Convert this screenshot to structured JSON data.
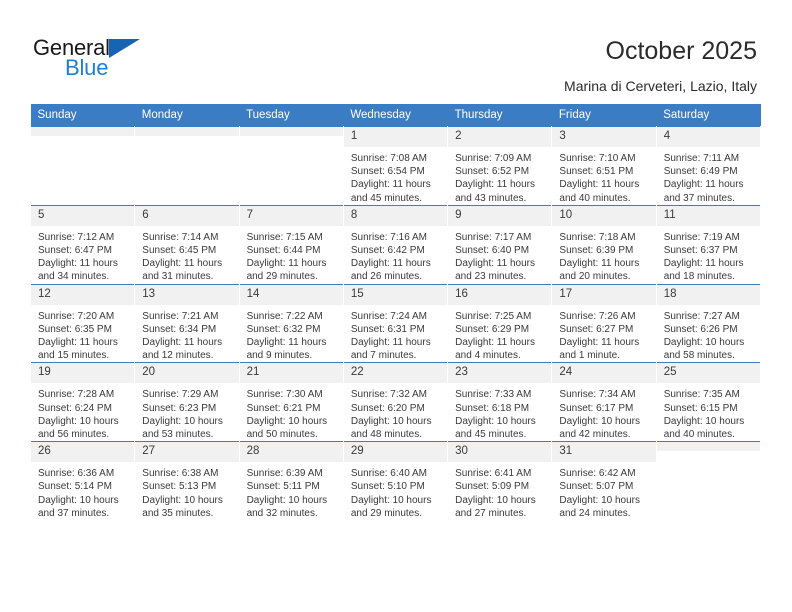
{
  "brand": {
    "name_top": "General",
    "name_bottom": "Blue",
    "triangle_color": "#1565b4",
    "blue_color": "#1f7fd4"
  },
  "header": {
    "title": "October 2025",
    "location": "Marina di Cerveteri, Lazio, Italy"
  },
  "theme": {
    "header_row_bg": "#3b7dc4",
    "header_row_text": "#ffffff",
    "daynum_bg": "#f1f1f1",
    "grid_line": "#3b7dc4",
    "body_text": "#3a3a3a"
  },
  "calendar": {
    "weekday_headers": [
      "Sunday",
      "Monday",
      "Tuesday",
      "Wednesday",
      "Thursday",
      "Friday",
      "Saturday"
    ],
    "weeks": [
      [
        {
          "day": "",
          "blank": true,
          "sunrise": "",
          "sunset": "",
          "daylight1": "",
          "daylight2": ""
        },
        {
          "day": "",
          "blank": true,
          "sunrise": "",
          "sunset": "",
          "daylight1": "",
          "daylight2": ""
        },
        {
          "day": "",
          "blank": true,
          "sunrise": "",
          "sunset": "",
          "daylight1": "",
          "daylight2": ""
        },
        {
          "day": "1",
          "sunrise": "Sunrise: 7:08 AM",
          "sunset": "Sunset: 6:54 PM",
          "daylight1": "Daylight: 11 hours",
          "daylight2": "and 45 minutes."
        },
        {
          "day": "2",
          "sunrise": "Sunrise: 7:09 AM",
          "sunset": "Sunset: 6:52 PM",
          "daylight1": "Daylight: 11 hours",
          "daylight2": "and 43 minutes."
        },
        {
          "day": "3",
          "sunrise": "Sunrise: 7:10 AM",
          "sunset": "Sunset: 6:51 PM",
          "daylight1": "Daylight: 11 hours",
          "daylight2": "and 40 minutes."
        },
        {
          "day": "4",
          "sunrise": "Sunrise: 7:11 AM",
          "sunset": "Sunset: 6:49 PM",
          "daylight1": "Daylight: 11 hours",
          "daylight2": "and 37 minutes."
        }
      ],
      [
        {
          "day": "5",
          "sunrise": "Sunrise: 7:12 AM",
          "sunset": "Sunset: 6:47 PM",
          "daylight1": "Daylight: 11 hours",
          "daylight2": "and 34 minutes."
        },
        {
          "day": "6",
          "sunrise": "Sunrise: 7:14 AM",
          "sunset": "Sunset: 6:45 PM",
          "daylight1": "Daylight: 11 hours",
          "daylight2": "and 31 minutes."
        },
        {
          "day": "7",
          "sunrise": "Sunrise: 7:15 AM",
          "sunset": "Sunset: 6:44 PM",
          "daylight1": "Daylight: 11 hours",
          "daylight2": "and 29 minutes."
        },
        {
          "day": "8",
          "sunrise": "Sunrise: 7:16 AM",
          "sunset": "Sunset: 6:42 PM",
          "daylight1": "Daylight: 11 hours",
          "daylight2": "and 26 minutes."
        },
        {
          "day": "9",
          "sunrise": "Sunrise: 7:17 AM",
          "sunset": "Sunset: 6:40 PM",
          "daylight1": "Daylight: 11 hours",
          "daylight2": "and 23 minutes."
        },
        {
          "day": "10",
          "sunrise": "Sunrise: 7:18 AM",
          "sunset": "Sunset: 6:39 PM",
          "daylight1": "Daylight: 11 hours",
          "daylight2": "and 20 minutes."
        },
        {
          "day": "11",
          "sunrise": "Sunrise: 7:19 AM",
          "sunset": "Sunset: 6:37 PM",
          "daylight1": "Daylight: 11 hours",
          "daylight2": "and 18 minutes."
        }
      ],
      [
        {
          "day": "12",
          "sunrise": "Sunrise: 7:20 AM",
          "sunset": "Sunset: 6:35 PM",
          "daylight1": "Daylight: 11 hours",
          "daylight2": "and 15 minutes."
        },
        {
          "day": "13",
          "sunrise": "Sunrise: 7:21 AM",
          "sunset": "Sunset: 6:34 PM",
          "daylight1": "Daylight: 11 hours",
          "daylight2": "and 12 minutes."
        },
        {
          "day": "14",
          "sunrise": "Sunrise: 7:22 AM",
          "sunset": "Sunset: 6:32 PM",
          "daylight1": "Daylight: 11 hours",
          "daylight2": "and 9 minutes."
        },
        {
          "day": "15",
          "sunrise": "Sunrise: 7:24 AM",
          "sunset": "Sunset: 6:31 PM",
          "daylight1": "Daylight: 11 hours",
          "daylight2": "and 7 minutes."
        },
        {
          "day": "16",
          "sunrise": "Sunrise: 7:25 AM",
          "sunset": "Sunset: 6:29 PM",
          "daylight1": "Daylight: 11 hours",
          "daylight2": "and 4 minutes."
        },
        {
          "day": "17",
          "sunrise": "Sunrise: 7:26 AM",
          "sunset": "Sunset: 6:27 PM",
          "daylight1": "Daylight: 11 hours",
          "daylight2": "and 1 minute."
        },
        {
          "day": "18",
          "sunrise": "Sunrise: 7:27 AM",
          "sunset": "Sunset: 6:26 PM",
          "daylight1": "Daylight: 10 hours",
          "daylight2": "and 58 minutes."
        }
      ],
      [
        {
          "day": "19",
          "sunrise": "Sunrise: 7:28 AM",
          "sunset": "Sunset: 6:24 PM",
          "daylight1": "Daylight: 10 hours",
          "daylight2": "and 56 minutes."
        },
        {
          "day": "20",
          "sunrise": "Sunrise: 7:29 AM",
          "sunset": "Sunset: 6:23 PM",
          "daylight1": "Daylight: 10 hours",
          "daylight2": "and 53 minutes."
        },
        {
          "day": "21",
          "sunrise": "Sunrise: 7:30 AM",
          "sunset": "Sunset: 6:21 PM",
          "daylight1": "Daylight: 10 hours",
          "daylight2": "and 50 minutes."
        },
        {
          "day": "22",
          "sunrise": "Sunrise: 7:32 AM",
          "sunset": "Sunset: 6:20 PM",
          "daylight1": "Daylight: 10 hours",
          "daylight2": "and 48 minutes."
        },
        {
          "day": "23",
          "sunrise": "Sunrise: 7:33 AM",
          "sunset": "Sunset: 6:18 PM",
          "daylight1": "Daylight: 10 hours",
          "daylight2": "and 45 minutes."
        },
        {
          "day": "24",
          "sunrise": "Sunrise: 7:34 AM",
          "sunset": "Sunset: 6:17 PM",
          "daylight1": "Daylight: 10 hours",
          "daylight2": "and 42 minutes."
        },
        {
          "day": "25",
          "sunrise": "Sunrise: 7:35 AM",
          "sunset": "Sunset: 6:15 PM",
          "daylight1": "Daylight: 10 hours",
          "daylight2": "and 40 minutes."
        }
      ],
      [
        {
          "day": "26",
          "sunrise": "Sunrise: 6:36 AM",
          "sunset": "Sunset: 5:14 PM",
          "daylight1": "Daylight: 10 hours",
          "daylight2": "and 37 minutes."
        },
        {
          "day": "27",
          "sunrise": "Sunrise: 6:38 AM",
          "sunset": "Sunset: 5:13 PM",
          "daylight1": "Daylight: 10 hours",
          "daylight2": "and 35 minutes."
        },
        {
          "day": "28",
          "sunrise": "Sunrise: 6:39 AM",
          "sunset": "Sunset: 5:11 PM",
          "daylight1": "Daylight: 10 hours",
          "daylight2": "and 32 minutes."
        },
        {
          "day": "29",
          "sunrise": "Sunrise: 6:40 AM",
          "sunset": "Sunset: 5:10 PM",
          "daylight1": "Daylight: 10 hours",
          "daylight2": "and 29 minutes."
        },
        {
          "day": "30",
          "sunrise": "Sunrise: 6:41 AM",
          "sunset": "Sunset: 5:09 PM",
          "daylight1": "Daylight: 10 hours",
          "daylight2": "and 27 minutes."
        },
        {
          "day": "31",
          "sunrise": "Sunrise: 6:42 AM",
          "sunset": "Sunset: 5:07 PM",
          "daylight1": "Daylight: 10 hours",
          "daylight2": "and 24 minutes."
        },
        {
          "day": "",
          "blank": true,
          "sunrise": "",
          "sunset": "",
          "daylight1": "",
          "daylight2": ""
        }
      ]
    ]
  }
}
